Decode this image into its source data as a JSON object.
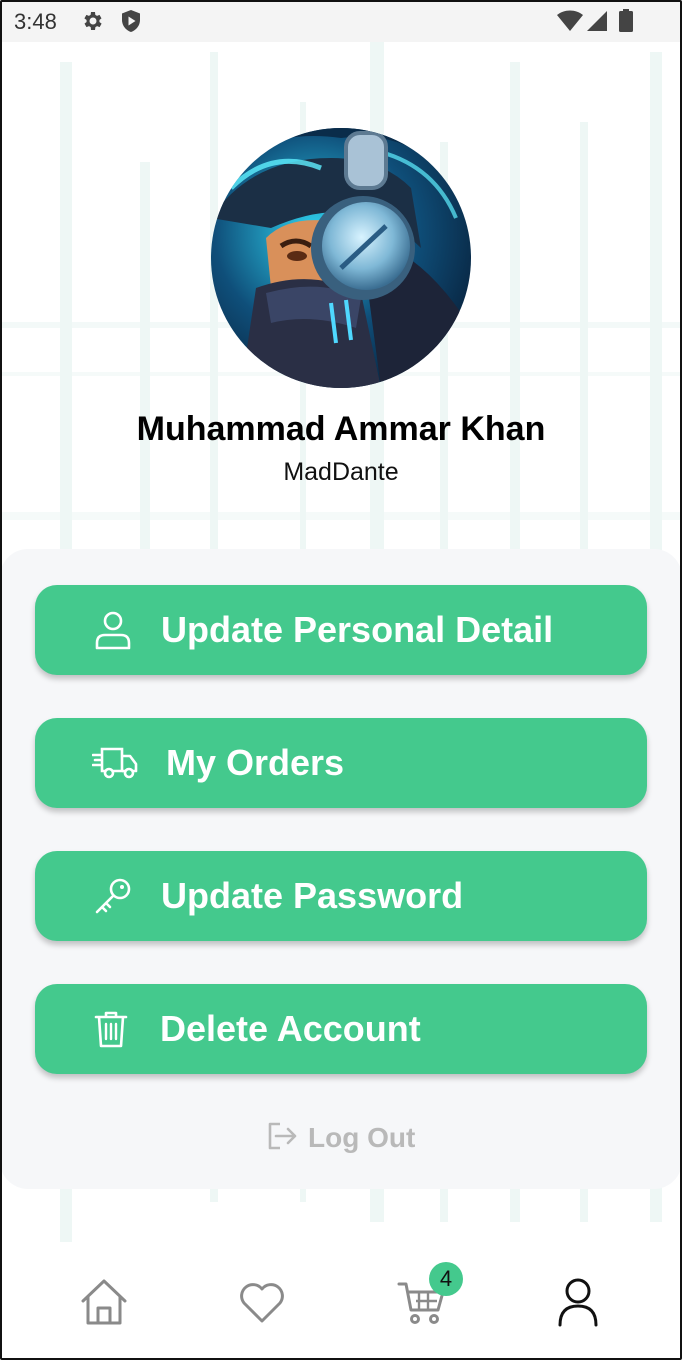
{
  "status_bar": {
    "time": "3:48",
    "icons": [
      "settings-gear-icon",
      "shield-icon",
      "wifi-icon",
      "signal-icon",
      "battery-icon"
    ]
  },
  "profile": {
    "full_name": "Muhammad Ammar Khan",
    "username": "MadDante",
    "avatar": "gamer-avatar-with-headphones"
  },
  "menu": {
    "items": [
      {
        "label": "Update Personal Detail",
        "icon": "person-icon"
      },
      {
        "label": "My Orders",
        "icon": "truck-icon"
      },
      {
        "label": "Update Password",
        "icon": "key-icon"
      },
      {
        "label": "Delete Account",
        "icon": "trash-icon"
      }
    ],
    "logout": {
      "label": "Log Out",
      "icon": "logout-icon"
    }
  },
  "bottom_nav": {
    "items": [
      {
        "name": "home",
        "icon": "home-icon",
        "active": false
      },
      {
        "name": "favorites",
        "icon": "heart-icon",
        "active": false
      },
      {
        "name": "cart",
        "icon": "cart-icon",
        "active": false
      },
      {
        "name": "profile",
        "icon": "user-icon",
        "active": true
      }
    ],
    "cart_badge": "4"
  },
  "colors": {
    "accent": "#44c98d",
    "card_background": "#f6f7f9",
    "logout_text": "#b9b9b9",
    "inactive_nav": "#8a8a8a"
  }
}
